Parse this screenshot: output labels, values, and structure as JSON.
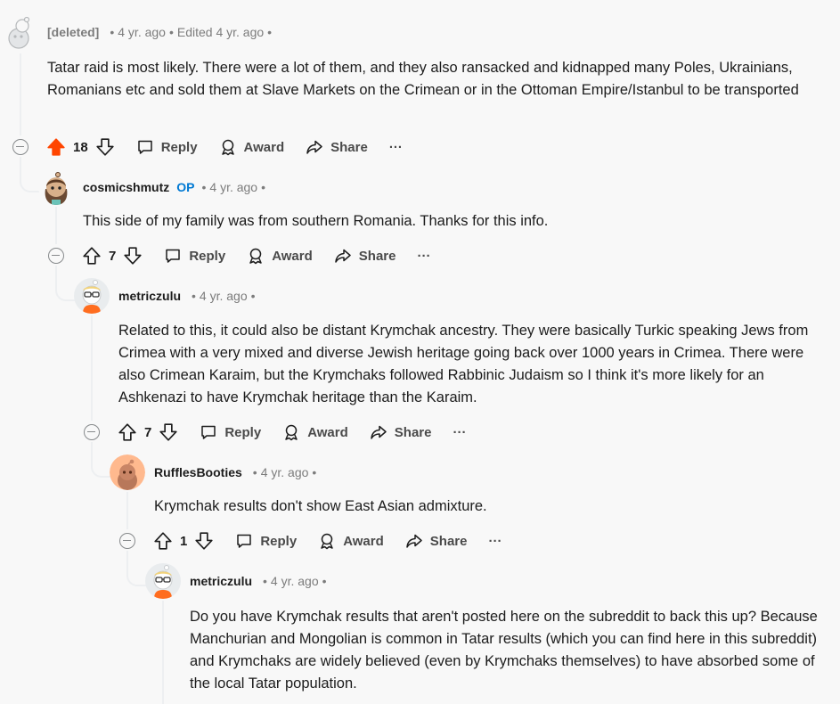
{
  "comments": [
    {
      "username": "[deleted]",
      "op_badge": "",
      "time": "4 yr. ago",
      "edited": "Edited 4 yr. ago",
      "text": "Tatar raid is most likely. There were a lot of them, and they also ransacked and kidnapped many Poles, Ukrainians, Romanians etc and sold them at Slave Markets on the Crimean or in the Ottoman Empire/Istanbul to be transported",
      "votes": "18",
      "upvoted": true
    },
    {
      "username": "cosmicshmutz",
      "op_badge": "OP",
      "time": "4 yr. ago",
      "text": "This side of my family was from southern Romania. Thanks for this info.",
      "votes": "7"
    },
    {
      "username": "metriczulu",
      "time": "4 yr. ago",
      "text": "Related to this, it could also be distant Krymchak ancestry. They were basically Turkic speaking Jews from Crimea with a very mixed and diverse Jewish heritage going back over 1000 years in Crimea. There were also Crimean Karaim, but the Krymchaks followed Rabbinic Judaism so I think it's more likely for an Ashkenazi to have Krymchak heritage than the Karaim.",
      "votes": "7"
    },
    {
      "username": "RufflesBooties",
      "time": "4 yr. ago",
      "text": "Krymchak results don't show East Asian admixture.",
      "votes": "1"
    },
    {
      "username": "metriczulu",
      "time": "4 yr. ago",
      "text": "Do you have Krymchak results that aren't posted here on the subreddit to back this up? Because Manchurian and Mongolian is common in Tatar results (which you can find here in this subreddit) and Krymchaks are widely believed (even by Krymchaks themselves) to have absorbed some of the local Tatar population."
    }
  ],
  "labels": {
    "reply": "Reply",
    "award": "Award",
    "share": "Share",
    "more": "···",
    "dot": "•"
  },
  "colors": {
    "upvote_active": "#ff4500",
    "op": "#0079d3",
    "meta": "#7c7c7c",
    "thread_line": "#edeff1"
  },
  "icons": [
    "snoo-avatar-icon",
    "collapse-icon",
    "upvote-icon",
    "downvote-icon",
    "comment-icon",
    "award-icon",
    "share-icon",
    "more-icon"
  ]
}
